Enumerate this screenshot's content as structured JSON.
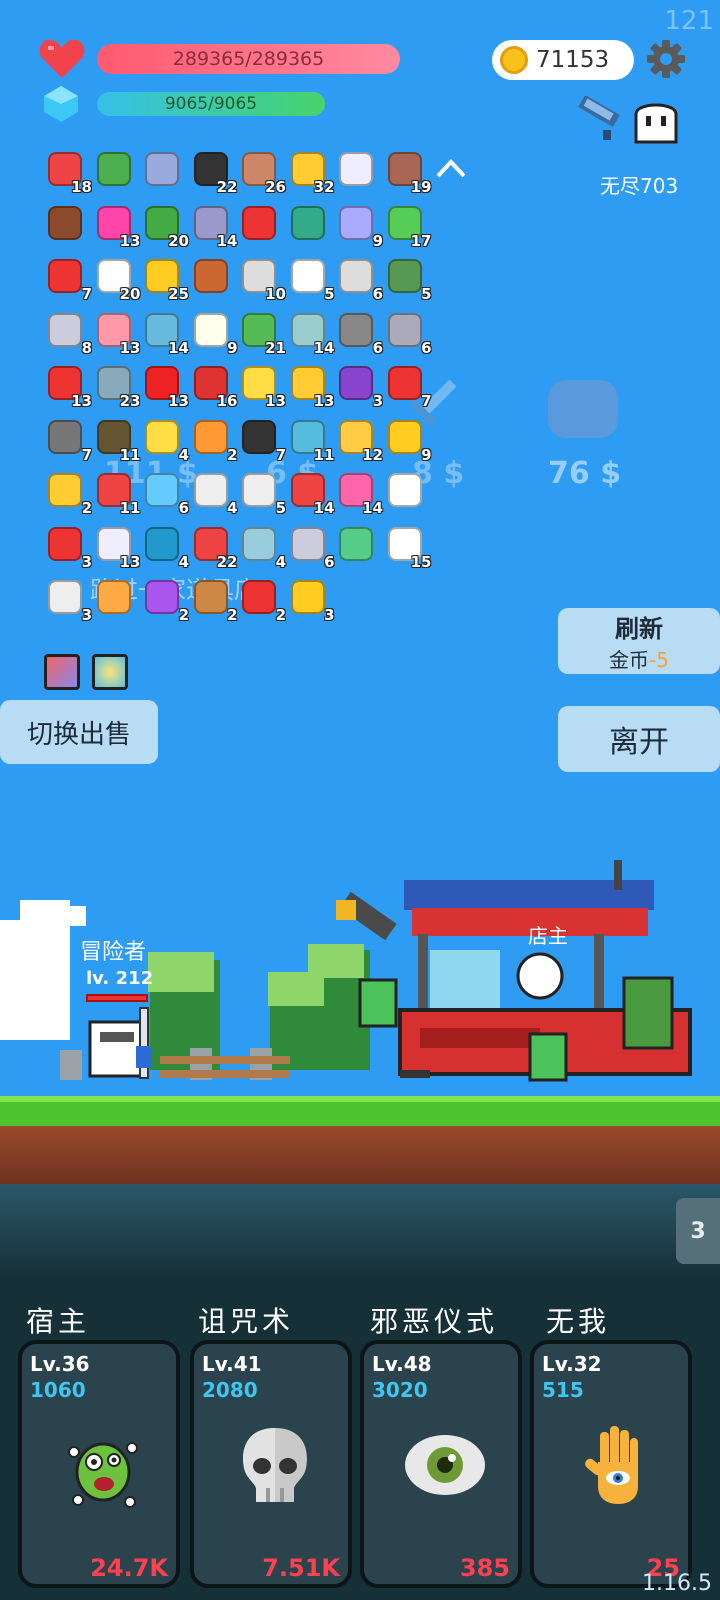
{
  "fps": "121",
  "version": "1.16.5",
  "player": {
    "hp": "289365/289365",
    "mp": "9065/9065",
    "gold": "71153",
    "mode": "无尽703"
  },
  "inventory": [
    {
      "icon": "jam-jar-icon",
      "color": "#e44",
      "count": "18"
    },
    {
      "icon": "green-book-icon",
      "color": "#4caf50",
      "count": ""
    },
    {
      "icon": "magnifier-icon",
      "color": "#9ad",
      "count": ""
    },
    {
      "icon": "bat-icon",
      "color": "#333",
      "count": "22"
    },
    {
      "icon": "donut-icon",
      "color": "#c86",
      "count": "26"
    },
    {
      "icon": "sun-cloud-icon",
      "color": "#fc3",
      "count": "32"
    },
    {
      "icon": "wing-icon",
      "color": "#eef",
      "count": ""
    },
    {
      "icon": "tombstone-icon",
      "color": "#a65",
      "count": "19"
    },
    {
      "icon": "mushroom-icon",
      "color": "#8b4a2b",
      "count": ""
    },
    {
      "icon": "potion-flask-icon",
      "color": "#f4a",
      "count": "13"
    },
    {
      "icon": "helmet-icon",
      "color": "#4a4",
      "count": "20"
    },
    {
      "icon": "star-shield-icon",
      "color": "#99c",
      "count": "14"
    },
    {
      "icon": "magnet-icon",
      "color": "#e33",
      "count": ""
    },
    {
      "icon": "tent-icon",
      "color": "#3a8",
      "count": ""
    },
    {
      "icon": "pill-icon",
      "color": "#aaf",
      "count": "9"
    },
    {
      "icon": "goblin-icon",
      "color": "#5c5",
      "count": "17"
    },
    {
      "icon": "hearts-icon",
      "color": "#e33",
      "count": "7"
    },
    {
      "icon": "flower-icon",
      "color": "#fff",
      "count": "20"
    },
    {
      "icon": "crown-icon",
      "color": "#fc2",
      "count": "25"
    },
    {
      "icon": "drumstick-icon",
      "color": "#c63",
      "count": ""
    },
    {
      "icon": "hook-icon",
      "color": "#ddd",
      "count": "10"
    },
    {
      "icon": "dice-icon",
      "color": "#fff",
      "count": "5"
    },
    {
      "icon": "cards-icon",
      "color": "#ddd",
      "count": "6"
    },
    {
      "icon": "grenade-icon",
      "color": "#595",
      "count": "5"
    },
    {
      "icon": "fishhook-icon",
      "color": "#ccd",
      "count": "8"
    },
    {
      "icon": "ice-cream-icon",
      "color": "#f9a",
      "count": "13"
    },
    {
      "icon": "scroll-icon",
      "color": "#6bd",
      "count": "14"
    },
    {
      "icon": "fried-egg-icon",
      "color": "#ffe",
      "count": "9"
    },
    {
      "icon": "money-icon",
      "color": "#5b5",
      "count": "21"
    },
    {
      "icon": "tape-icon",
      "color": "#9cc",
      "count": "14"
    },
    {
      "icon": "compass-icon",
      "color": "#888",
      "count": "6"
    },
    {
      "icon": "axe-icon",
      "color": "#aab",
      "count": "6"
    },
    {
      "icon": "red-mushroom-icon",
      "color": "#e33",
      "count": "13"
    },
    {
      "icon": "shield-icon",
      "color": "#8ab",
      "count": "23"
    },
    {
      "icon": "apple-icon",
      "color": "#e22",
      "count": "13"
    },
    {
      "icon": "red-shield-icon",
      "color": "#d33",
      "count": "16"
    },
    {
      "icon": "halo-icon",
      "color": "#fd4",
      "count": "13"
    },
    {
      "icon": "note-icon",
      "color": "#fc3",
      "count": "13"
    },
    {
      "icon": "purple-box-icon",
      "color": "#84c",
      "count": "3"
    },
    {
      "icon": "heart-icon",
      "color": "#e33",
      "count": "7"
    },
    {
      "icon": "mace-icon",
      "color": "#777",
      "count": "7"
    },
    {
      "icon": "coconut-icon",
      "color": "#653",
      "count": "11"
    },
    {
      "icon": "ring-icon",
      "color": "#fd4",
      "count": "4"
    },
    {
      "icon": "orange-book-icon",
      "color": "#f93",
      "count": "2"
    },
    {
      "icon": "cauldron-icon",
      "color": "#333",
      "count": "7"
    },
    {
      "icon": "speech-icon",
      "color": "#5bd",
      "count": "11"
    },
    {
      "icon": "glove-icon",
      "color": "#fc4",
      "count": "12"
    },
    {
      "icon": "sunflower-icon",
      "color": "#fc2",
      "count": "9"
    },
    {
      "icon": "magic-wand-icon",
      "color": "#fc3",
      "count": "2"
    },
    {
      "icon": "watermelon-icon",
      "color": "#e44",
      "count": "11"
    },
    {
      "icon": "blue-potion-icon",
      "color": "#6cf",
      "count": "6"
    },
    {
      "icon": "cloud-icon",
      "color": "#eee",
      "count": "4"
    },
    {
      "icon": "clipboard-icon",
      "color": "#eee",
      "count": "5"
    },
    {
      "icon": "capsule-icon",
      "color": "#e44",
      "count": "14"
    },
    {
      "icon": "pink-bottle-icon",
      "color": "#f6a",
      "count": "14"
    },
    {
      "icon": "chat-bubble-icon",
      "color": "#fff",
      "count": ""
    },
    {
      "icon": "strawberry-icon",
      "color": "#e33",
      "count": "3"
    },
    {
      "icon": "ghost-bunny-icon",
      "color": "#eef",
      "count": "13"
    },
    {
      "icon": "sapphire-icon",
      "color": "#29c",
      "count": "4"
    },
    {
      "icon": "sock-icon",
      "color": "#e44",
      "count": "22"
    },
    {
      "icon": "crosshair-icon",
      "color": "#9cd",
      "count": "4"
    },
    {
      "icon": "sword-icon",
      "color": "#ccd",
      "count": "6"
    },
    {
      "icon": "spirit-icon",
      "color": "#5c8",
      "count": ""
    },
    {
      "icon": "star-card-icon",
      "color": "#fff",
      "count": "15"
    },
    {
      "icon": "envelope-icon",
      "color": "#eee",
      "count": "3"
    },
    {
      "icon": "meteor-icon",
      "color": "#fa4",
      "count": ""
    },
    {
      "icon": "crystal-ball-icon",
      "color": "#a5e",
      "count": "2"
    },
    {
      "icon": "bow-icon",
      "color": "#c84",
      "count": "2"
    },
    {
      "icon": "gift-icon",
      "color": "#e33",
      "count": "2"
    },
    {
      "icon": "coin-stack-icon",
      "color": "#fc2",
      "count": "3"
    }
  ],
  "shop": {
    "prices": [
      "111 $",
      "6 $",
      "8 $",
      "76 $"
    ],
    "title": "路过一家道具店",
    "refresh_label": "刷新",
    "refresh_cost_label": "金币",
    "refresh_cost": "-5",
    "leave_label": "离开",
    "switch_label": "切换出售"
  },
  "scene": {
    "adventurer_name": "冒险者",
    "adventurer_level": "lv. 212",
    "shopkeeper": "店主"
  },
  "tab_number": "3",
  "skills": [
    {
      "name": "宿主",
      "level": "Lv.36",
      "power": "1060",
      "value": "24.7K",
      "icon": "green-monster-icon"
    },
    {
      "name": "诅咒术",
      "level": "Lv.41",
      "power": "2080",
      "value": "7.51K",
      "icon": "skull-icon"
    },
    {
      "name": "邪恶仪式",
      "level": "Lv.48",
      "power": "3020",
      "value": "385",
      "icon": "eye-icon"
    },
    {
      "name": "无我",
      "level": "Lv.32",
      "power": "515",
      "value": "25",
      "icon": "hand-eye-icon"
    }
  ]
}
